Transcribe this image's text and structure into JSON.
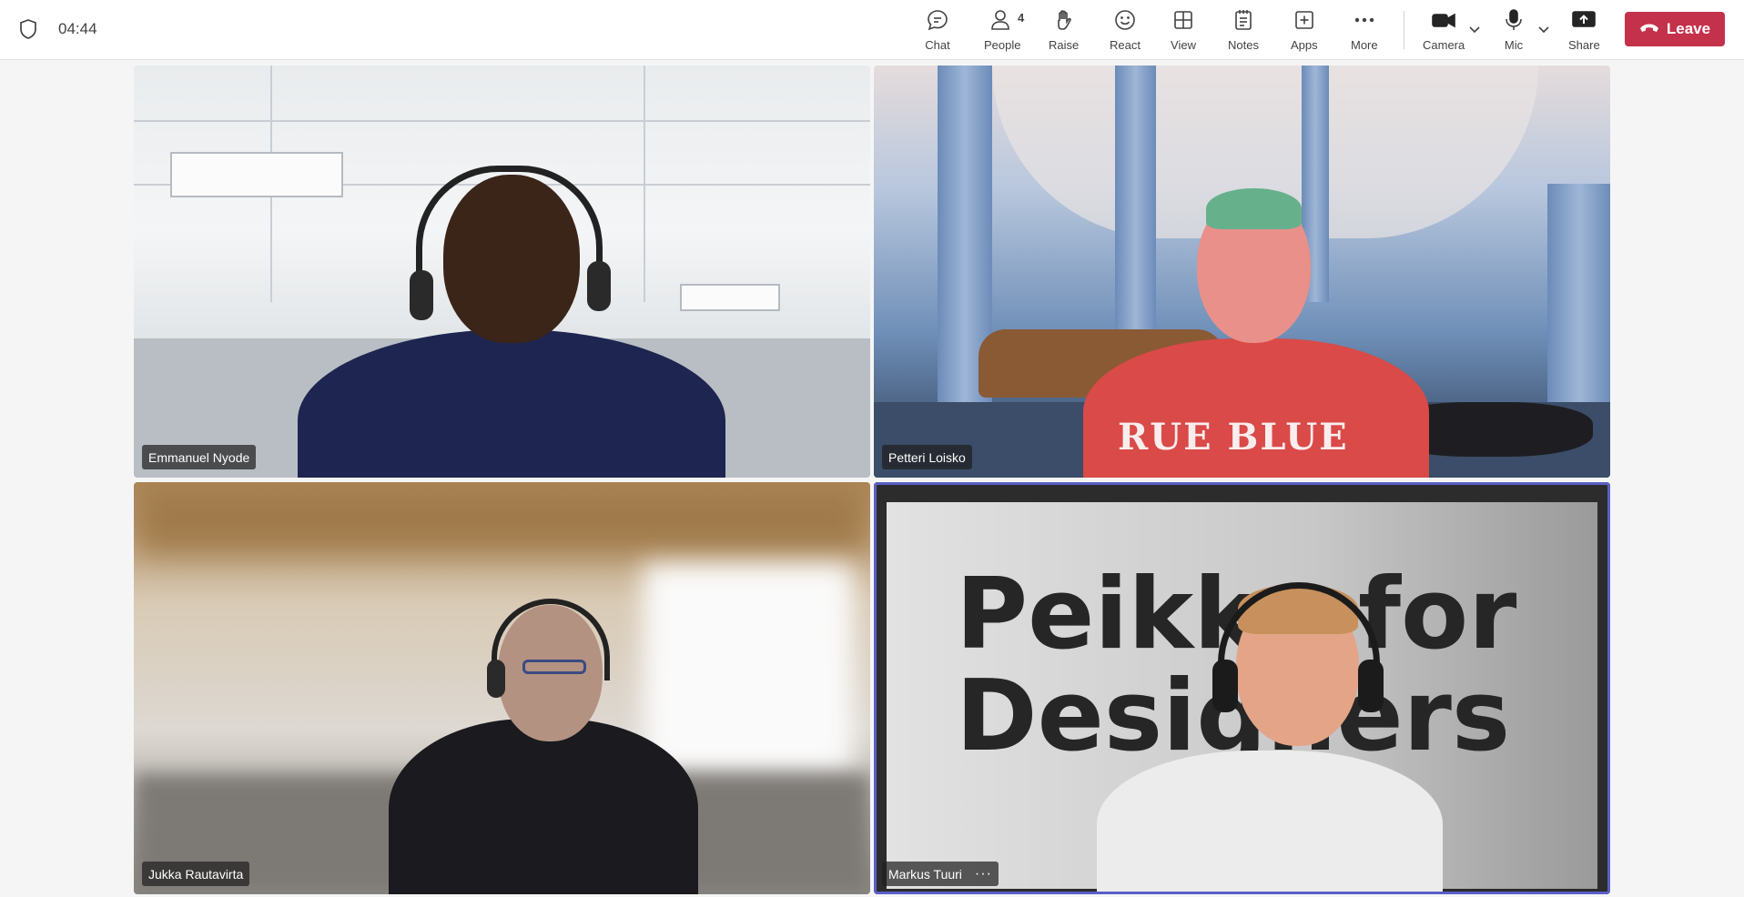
{
  "header": {
    "timer": "04:44",
    "toolbar": [
      {
        "id": "chat",
        "label": "Chat",
        "icon": "chat-icon"
      },
      {
        "id": "people",
        "label": "People",
        "icon": "people-icon",
        "count": "4"
      },
      {
        "id": "raise",
        "label": "Raise",
        "icon": "raise-hand-icon"
      },
      {
        "id": "react",
        "label": "React",
        "icon": "react-smiley-icon"
      },
      {
        "id": "view",
        "label": "View",
        "icon": "view-grid-icon"
      },
      {
        "id": "notes",
        "label": "Notes",
        "icon": "notes-icon"
      },
      {
        "id": "apps",
        "label": "Apps",
        "icon": "apps-add-icon"
      },
      {
        "id": "more",
        "label": "More",
        "icon": "more-dots-icon"
      },
      {
        "id": "camera",
        "label": "Camera",
        "icon": "camera-icon"
      },
      {
        "id": "mic",
        "label": "Mic",
        "icon": "mic-icon"
      },
      {
        "id": "share",
        "label": "Share",
        "icon": "share-tray-icon"
      }
    ],
    "leave_label": "Leave"
  },
  "participants": [
    {
      "name": "Emmanuel Nyode"
    },
    {
      "name": "Petteri Loisko",
      "shirt_text": "RUE BLUE"
    },
    {
      "name": "Jukka Rautavirta"
    },
    {
      "name": "Markus Tuuri",
      "more_label": "···",
      "background_text_line1": "Peikko for",
      "background_text_line2": "Designers"
    }
  ],
  "colors": {
    "leave": "#c4314b",
    "active_speaker_ring": "#5b5fc7"
  }
}
